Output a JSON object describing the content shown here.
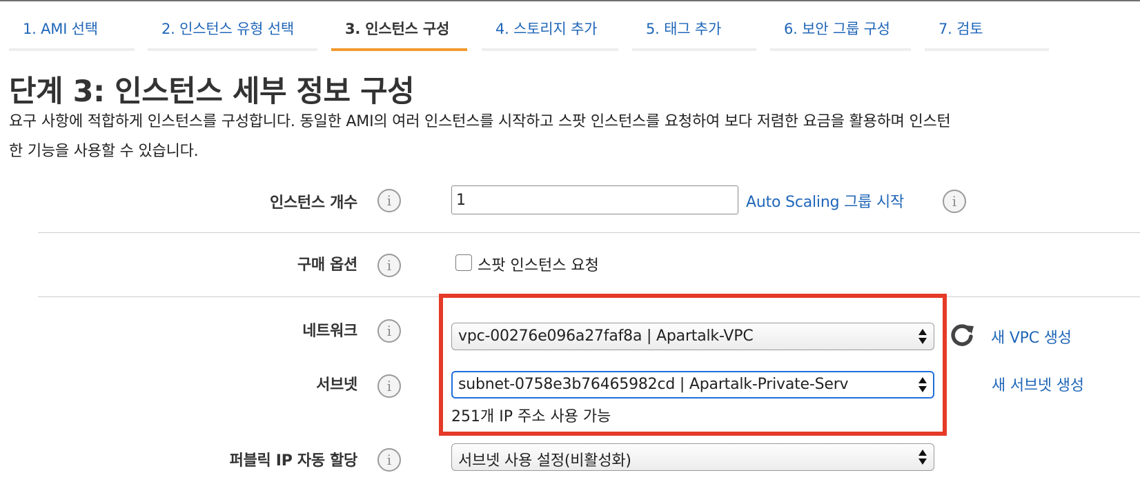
{
  "tabs": [
    {
      "label": "1. AMI 선택",
      "active": false
    },
    {
      "label": "2. 인스턴스 유형 선택",
      "active": false
    },
    {
      "label": "3. 인스턴스 구성",
      "active": true
    },
    {
      "label": "4. 스토리지 추가",
      "active": false
    },
    {
      "label": "5. 태그 추가",
      "active": false
    },
    {
      "label": "6. 보안 그룹 구성",
      "active": false
    },
    {
      "label": "7. 검토",
      "active": false
    }
  ],
  "page": {
    "title": "단계 3: 인스턴스 세부 정보 구성",
    "description_line1": "요구 사항에 적합하게 인스턴스를 구성합니다. 동일한 AMI의 여러 인스턴스를 시작하고 스팟 인스턴스를 요청하여 보다 저렴한 요금을 활용하며 인스턴",
    "description_line2": "한 기능을 사용할 수 있습니다."
  },
  "form": {
    "instance_count": {
      "label": "인스턴스 개수",
      "value": "1",
      "link": "Auto Scaling 그룹 시작"
    },
    "purchase_option": {
      "label": "구매 옵션",
      "checkbox_label": "스팟 인스턴스 요청",
      "checked": false
    },
    "network": {
      "label": "네트워크",
      "selected": "vpc-00276e096a27faf8a | Apartalk-VPC",
      "link": "새 VPC 생성"
    },
    "subnet": {
      "label": "서브넷",
      "selected": "subnet-0758e3b76465982cd | Apartalk-Private-Serv",
      "help": "251개 IP 주소 사용 가능",
      "link": "새 서브넷 생성"
    },
    "public_ip": {
      "label": "퍼블릭 IP 자동 할당",
      "selected": "서브넷 사용 설정(비활성화)"
    }
  },
  "icons": {
    "info": "info-icon",
    "refresh": "refresh-icon",
    "select_arrows": "updown-arrows-icon",
    "info_glyph": "i"
  },
  "colors": {
    "link": "#1f66b8",
    "active_tab_underline": "#f29a2e",
    "highlight_border": "#e43a27",
    "focus_border": "#1e6fdc"
  }
}
